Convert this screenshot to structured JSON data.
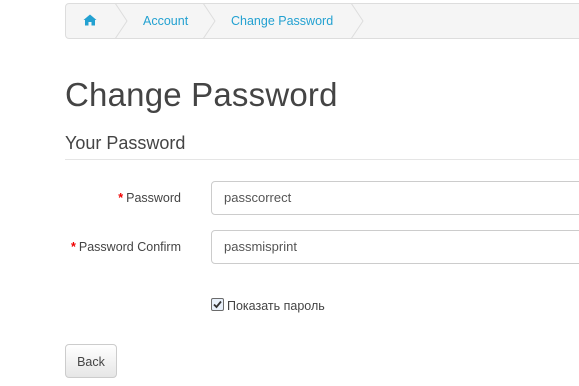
{
  "breadcrumb": {
    "home_icon": "home-icon",
    "items": [
      {
        "label": "Account"
      },
      {
        "label": "Change Password"
      }
    ]
  },
  "page": {
    "title": "Change Password"
  },
  "form": {
    "legend": "Your Password",
    "required_marker": "*",
    "password": {
      "label": "Password",
      "value": "passcorrect"
    },
    "password_confirm": {
      "label": "Password Confirm",
      "value": "passmisprint"
    },
    "show_password": {
      "label": "Показать пароль",
      "checked": true
    }
  },
  "buttons": {
    "back_label": "Back"
  },
  "colors": {
    "link": "#23a1d1",
    "required": "#f00000"
  }
}
